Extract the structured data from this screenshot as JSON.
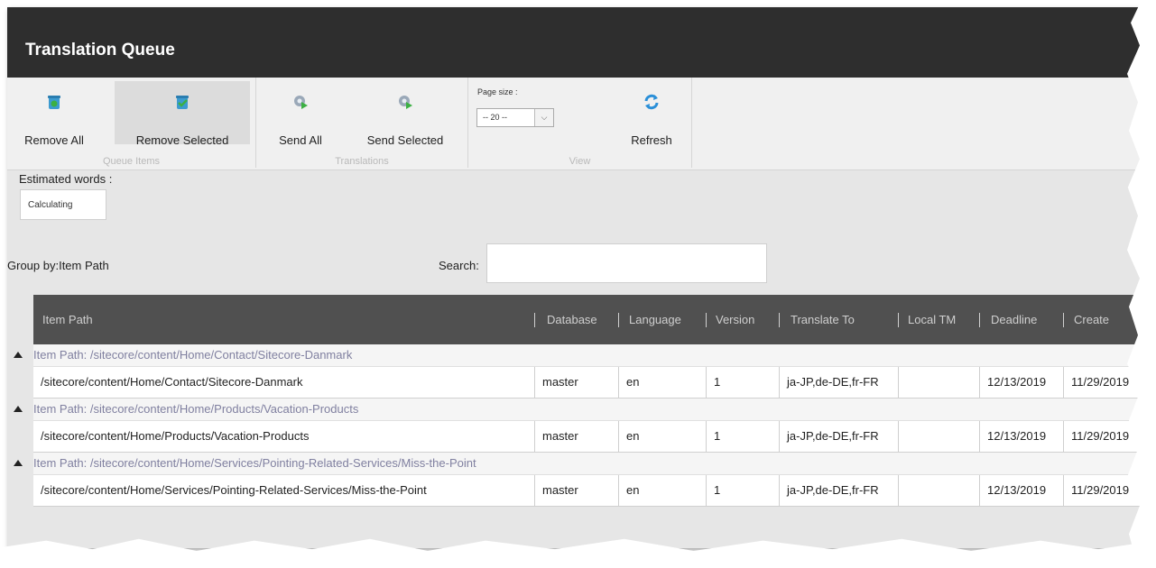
{
  "window": {
    "title": "Translation Queue"
  },
  "ribbon": {
    "queue_items": {
      "title": "Queue Items",
      "remove_all": {
        "label": "Remove All",
        "icon": "recycle-bin-icon"
      },
      "remove_selected": {
        "label": "Remove Selected",
        "icon": "recycle-bin-check-icon"
      }
    },
    "translations": {
      "title": "Translations",
      "send_all": {
        "label": "Send All",
        "icon": "gear-send-icon"
      },
      "send_selected": {
        "label": "Send Selected",
        "icon": "gear-send-icon"
      }
    },
    "view": {
      "title": "View",
      "page_size_label": "Page size :",
      "page_size_value": "-- 20 --",
      "refresh": {
        "label": "Refresh",
        "icon": "refresh-icon"
      }
    }
  },
  "estimate": {
    "label": "Estimated words :",
    "value": "Calculating"
  },
  "toolbar": {
    "group_by": "Group by:Item Path",
    "search_label": "Search:",
    "search_value": ""
  },
  "grid": {
    "columns": [
      "Item Path",
      "Database",
      "Language",
      "Version",
      "Translate To",
      "Local TM",
      "Deadline",
      "Create"
    ],
    "groups": [
      {
        "label": "Item Path: /sitecore/content/Home/Contact/Sitecore-Danmark",
        "row": {
          "path": "/sitecore/content/Home/Contact/Sitecore-Danmark",
          "database": "master",
          "language": "en",
          "version": "1",
          "translate_to": "ja-JP,de-DE,fr-FR",
          "local_tm": "",
          "deadline": "12/13/2019",
          "created": "11/29/2019"
        }
      },
      {
        "label": "Item Path: /sitecore/content/Home/Products/Vacation-Products",
        "row": {
          "path": "/sitecore/content/Home/Products/Vacation-Products",
          "database": "master",
          "language": "en",
          "version": "1",
          "translate_to": "ja-JP,de-DE,fr-FR",
          "local_tm": "",
          "deadline": "12/13/2019",
          "created": "11/29/2019"
        }
      },
      {
        "label": "Item Path: /sitecore/content/Home/Services/Pointing-Related-Services/Miss-the-Point",
        "row": {
          "path": "/sitecore/content/Home/Services/Pointing-Related-Services/Miss-the-Point",
          "database": "master",
          "language": "en",
          "version": "1",
          "translate_to": "ja-JP,de-DE,fr-FR",
          "local_tm": "",
          "deadline": "12/13/2019",
          "created": "11/29/2019"
        }
      }
    ]
  },
  "colors": {
    "titlebar": "#2e2e2e",
    "grid_header": "#505050",
    "group_text": "#8080a0"
  }
}
